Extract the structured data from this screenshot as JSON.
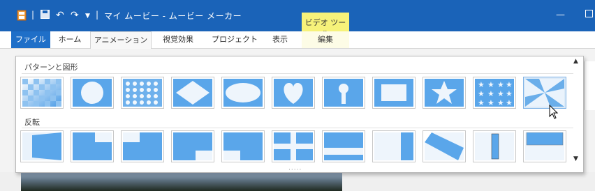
{
  "window": {
    "title": "マイ ムービー - ムービー メーカー",
    "context_group": "ビデオ ツール"
  },
  "tabs": [
    {
      "label": "ファイル"
    },
    {
      "label": "ホーム"
    },
    {
      "label": "アニメーション"
    },
    {
      "label": "視覚効果"
    },
    {
      "label": "プロジェクト"
    },
    {
      "label": "表示"
    },
    {
      "label": "編集"
    }
  ],
  "gallery": {
    "section1": {
      "title": "パターンと図形",
      "items": [
        "checkerboard",
        "circle",
        "dots",
        "diamond",
        "ellipse",
        "heart",
        "keyhole",
        "rectangle",
        "star",
        "stars",
        "pinwheel"
      ]
    },
    "section2": {
      "title": "反転",
      "items": [
        "flip-1",
        "flip-2",
        "flip-3",
        "flip-4",
        "flip-5",
        "flip-6",
        "flip-7",
        "flip-8",
        "flip-9",
        "flip-10",
        "flip-11"
      ]
    },
    "grip": "·····"
  },
  "colors": {
    "titlebar": "#1a63b8",
    "accent": "#3c8ee0",
    "tile_light": "#e6f1fb",
    "context": "#f6f27a"
  }
}
